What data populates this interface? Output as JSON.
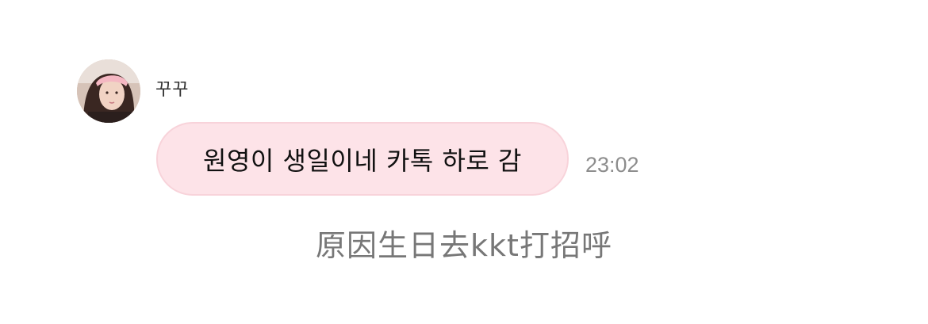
{
  "message": {
    "sender_name": "꾸꾸",
    "avatar_icon": "profile-photo",
    "text": "원영이 생일이네 카톡 하로 감",
    "time": "23:02",
    "bubble_color": "#fde3e8"
  },
  "caption": {
    "text": "原因生日去kkt打招呼"
  }
}
